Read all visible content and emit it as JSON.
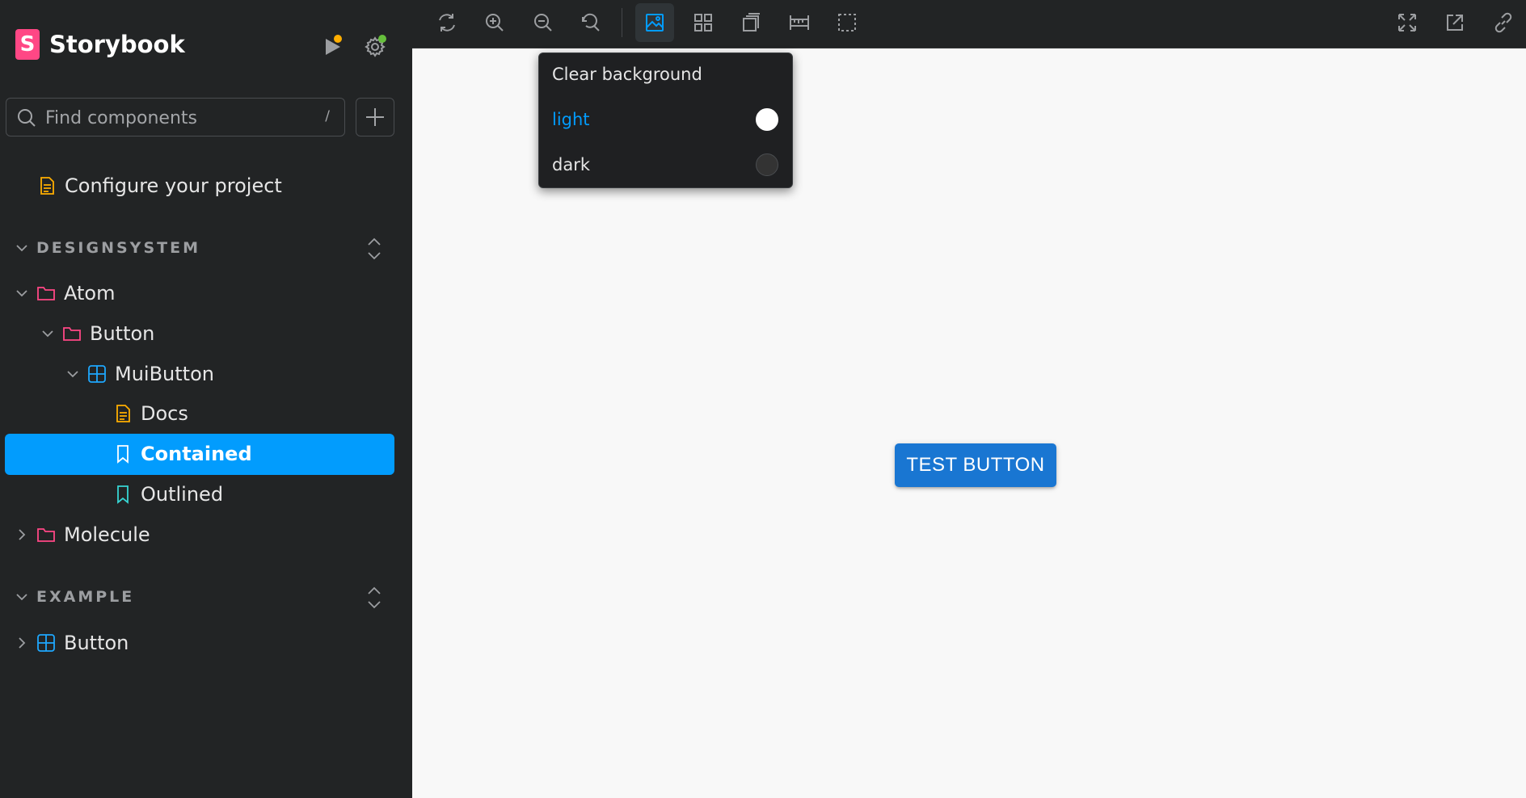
{
  "brand": {
    "logo_letter": "S",
    "name": "Storybook"
  },
  "sidebar": {
    "search": {
      "placeholder": "Find components",
      "shortcut": "/"
    },
    "configure_label": "Configure your project",
    "sections": [
      {
        "title": "DESIGNSYSTEM"
      },
      {
        "title": "EXAMPLE"
      }
    ],
    "tree": {
      "atom": "Atom",
      "button": "Button",
      "muibutton": "MuiButton",
      "docs": "Docs",
      "contained": "Contained",
      "outlined": "Outlined",
      "molecule": "Molecule",
      "example_button": "Button"
    }
  },
  "backgrounds_menu": {
    "clear": "Clear background",
    "options": [
      {
        "label": "light",
        "color": "#ffffff",
        "selected": true
      },
      {
        "label": "dark",
        "color": "#333333",
        "selected": false
      }
    ]
  },
  "preview": {
    "button_label": "TEST BUTTON"
  },
  "colors": {
    "accent": "#029cfd",
    "brand": "#ff4785",
    "folder": "#ff4785",
    "component": "#1ea7fd",
    "docs": "#ffae00",
    "story": "#37d5d3",
    "mui_primary": "#1976d2"
  }
}
